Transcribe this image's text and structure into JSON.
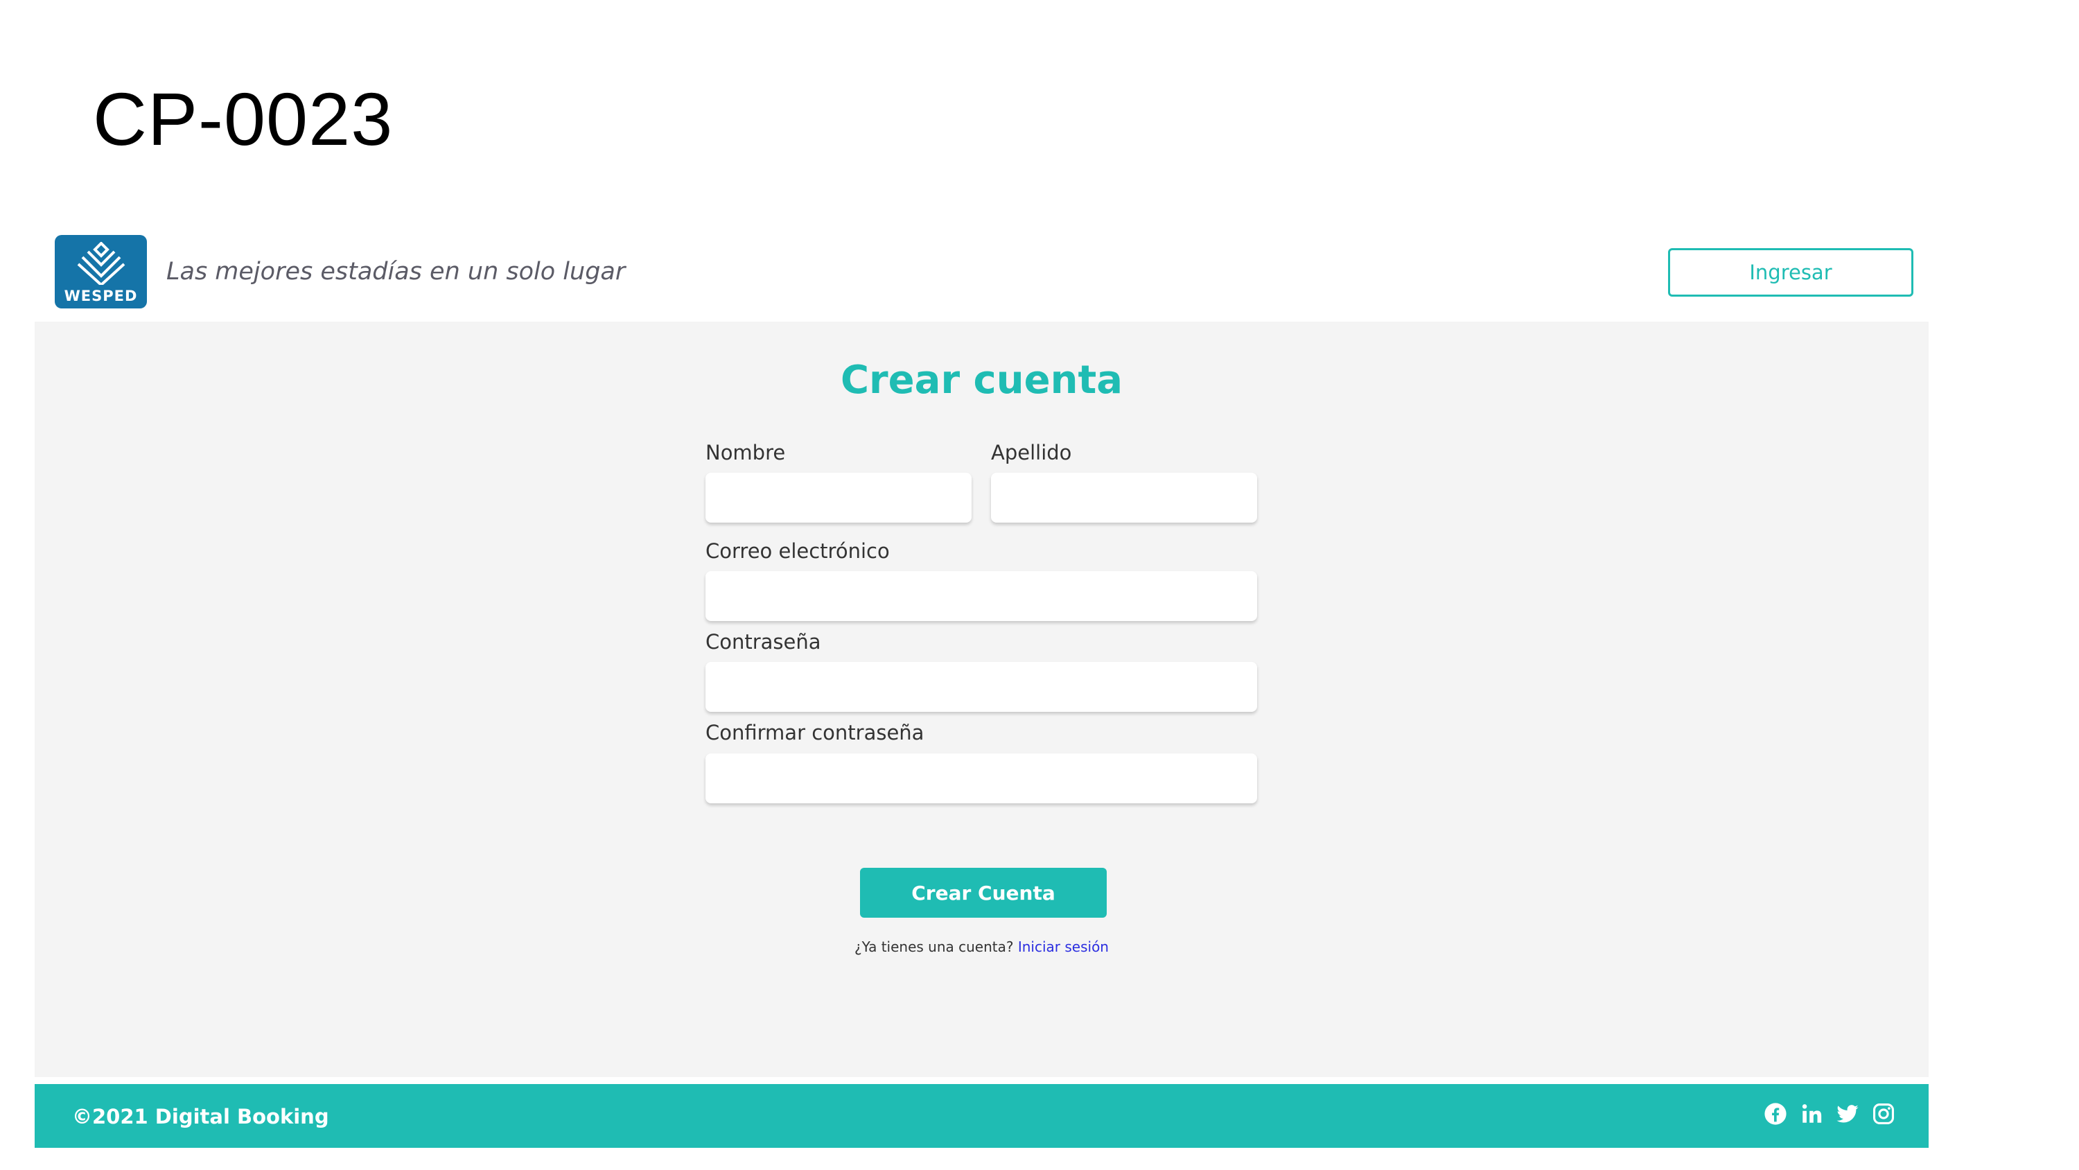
{
  "slide": {
    "title": "CP-0023"
  },
  "header": {
    "logo_text": "WESPED",
    "tagline": "Las mejores estadías en un solo lugar",
    "login_button": "Ingresar"
  },
  "form": {
    "title": "Crear cuenta",
    "fields": {
      "first_name": {
        "label": "Nombre",
        "value": ""
      },
      "last_name": {
        "label": "Apellido",
        "value": ""
      },
      "email": {
        "label": "Correo electrónico",
        "value": ""
      },
      "password": {
        "label": "Contraseña",
        "value": ""
      },
      "confirm_password": {
        "label": "Confirmar contraseña",
        "value": ""
      }
    },
    "submit_label": "Crear Cuenta",
    "login_prompt": "¿Ya tienes una cuenta?",
    "login_link": "Iniciar sesión"
  },
  "footer": {
    "copyright": "©2021 Digital Booking",
    "social_icons": [
      "facebook-icon",
      "linkedin-icon",
      "twitter-icon",
      "instagram-icon"
    ]
  },
  "colors": {
    "accent": "#1fbcb3",
    "logo_bg": "#1574a8",
    "link": "#2b2ee0",
    "page_bg": "#f4f4f4"
  }
}
